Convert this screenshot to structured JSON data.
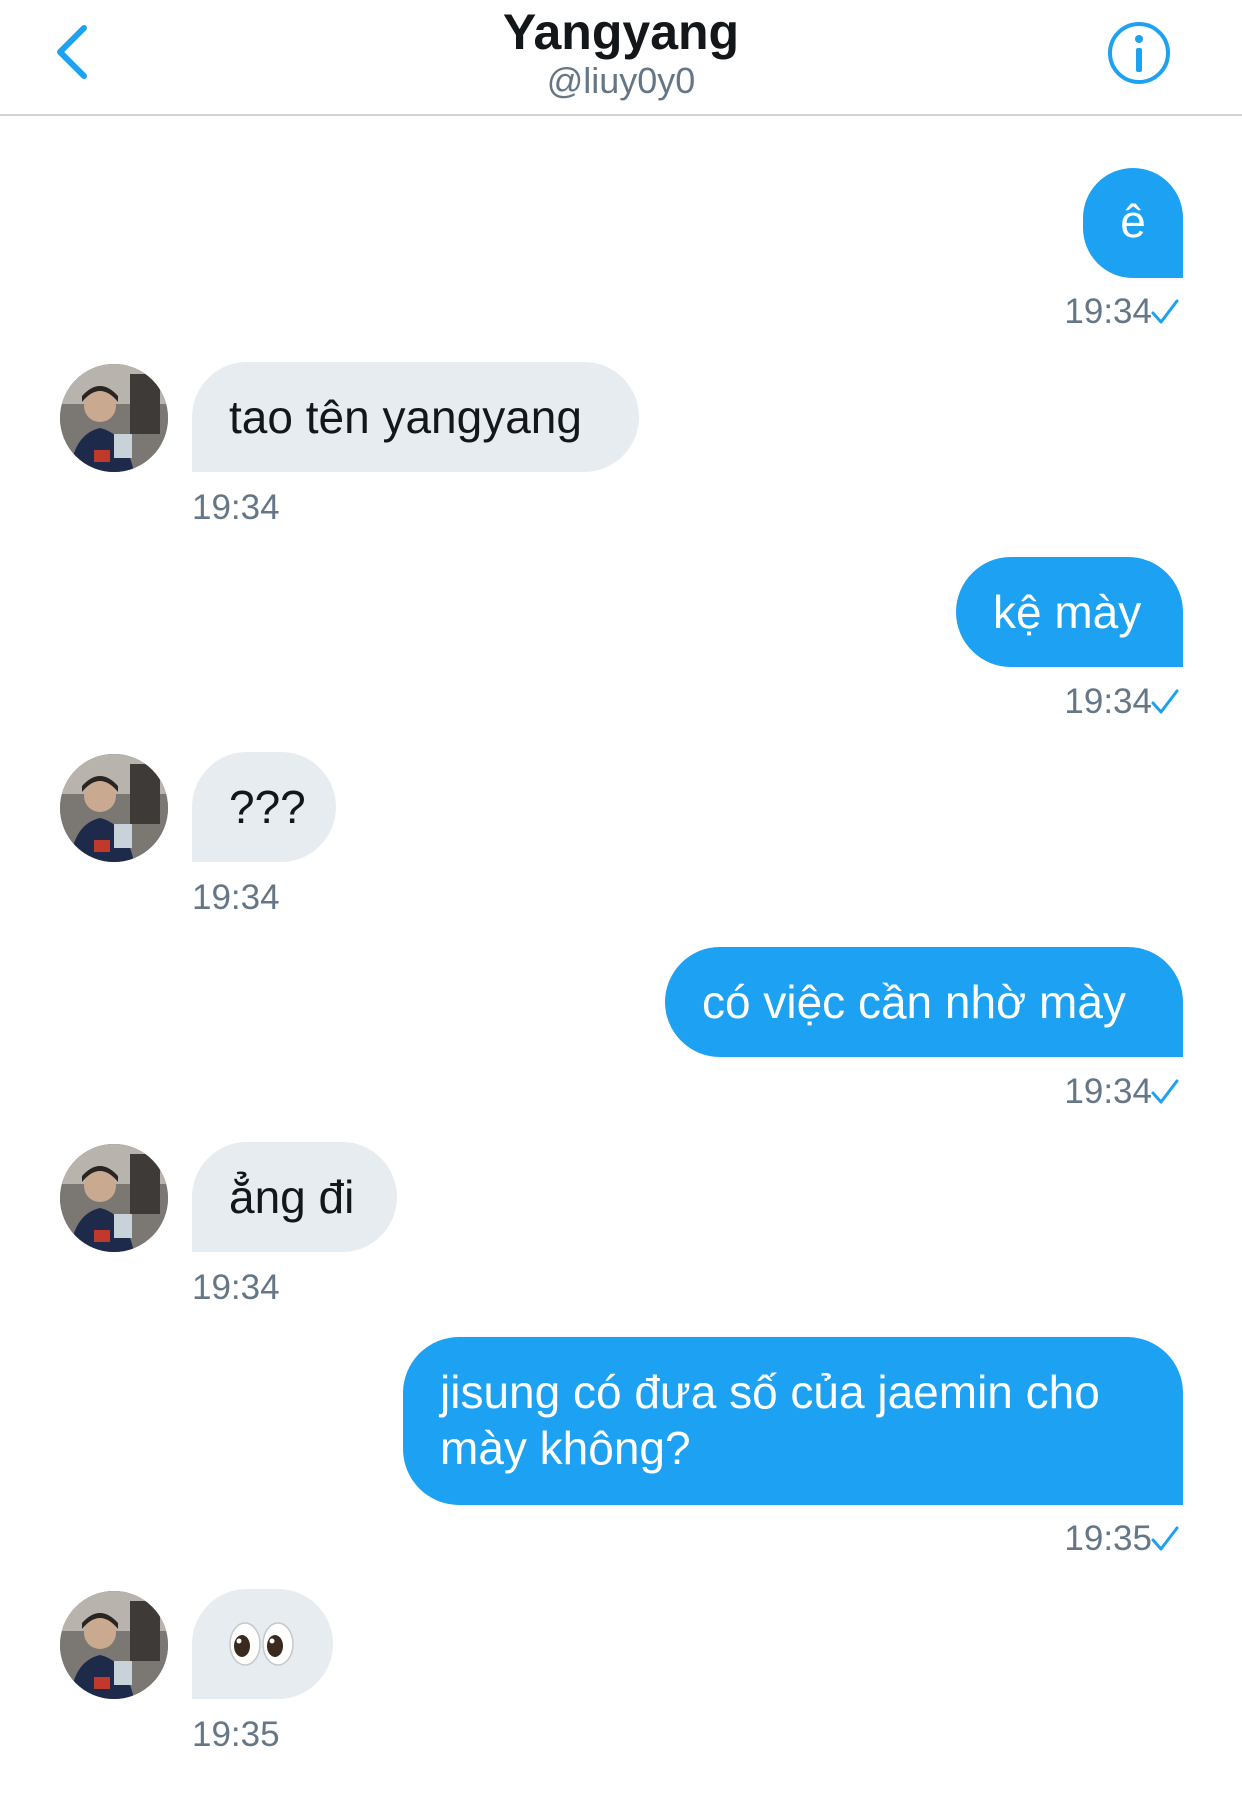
{
  "header": {
    "title": "Yangyang",
    "handle": "@liuy0y0"
  },
  "messages": [
    {
      "direction": "out",
      "text": "ê",
      "time": "19:34",
      "read": true
    },
    {
      "direction": "in",
      "text": "tao tên yangyang",
      "time": "19:34"
    },
    {
      "direction": "out",
      "text": "kệ mày",
      "time": "19:34",
      "read": true
    },
    {
      "direction": "in",
      "text": "???",
      "time": "19:34"
    },
    {
      "direction": "out",
      "text": "có việc cần nhờ mày",
      "time": "19:34",
      "read": true
    },
    {
      "direction": "in",
      "text": "ẳng đi",
      "time": "19:34"
    },
    {
      "direction": "out",
      "text_line1": "jisung có đưa số của jaemin cho",
      "text_line2": "mày không?",
      "time": "19:35",
      "read": true
    },
    {
      "direction": "in",
      "emoji": "eyes",
      "time": "19:35"
    }
  ],
  "colors": {
    "accent": "#1da1f2",
    "incoming_bubble": "#e6ecf0",
    "timestamp": "#657786"
  }
}
